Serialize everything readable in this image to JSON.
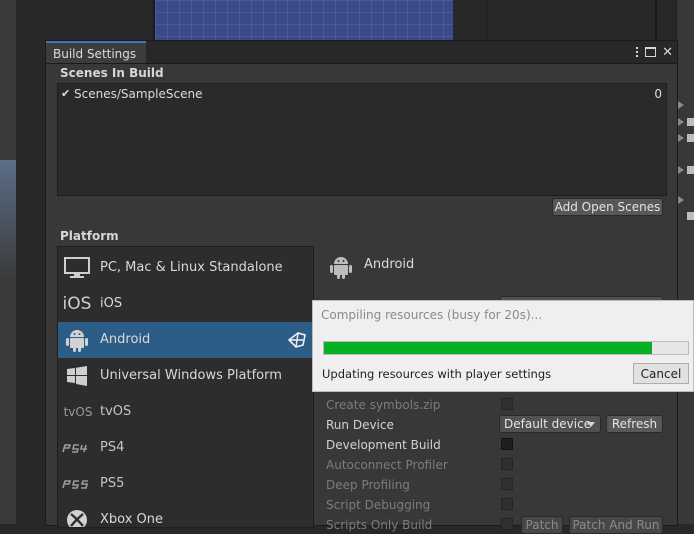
{
  "window": {
    "title": "Build Settings"
  },
  "scenes_in_build": {
    "label": "Scenes In Build",
    "scenes": [
      {
        "name": "Scenes/SampleScene",
        "index": "0",
        "checked": true
      }
    ],
    "add_open_scenes_label": "Add Open Scenes"
  },
  "platform": {
    "label": "Platform",
    "items": [
      {
        "label": "PC, Mac & Linux Standalone",
        "icon": "monitor-icon"
      },
      {
        "label": "iOS",
        "icon": "ios-icon",
        "icon_text": "iOS"
      },
      {
        "label": "Android",
        "icon": "android-icon",
        "selected": true
      },
      {
        "label": "Universal Windows Platform",
        "icon": "windows-icon"
      },
      {
        "label": "tvOS",
        "icon": "tvos-icon",
        "icon_text": "tvOS"
      },
      {
        "label": "PS4",
        "icon": "ps4-icon"
      },
      {
        "label": "PS5",
        "icon": "ps5-icon"
      },
      {
        "label": "Xbox One",
        "icon": "xbox-icon"
      }
    ],
    "selected_name": "Android"
  },
  "android_settings": {
    "create_symbols_zip": "Create symbols.zip",
    "run_device": "Run Device",
    "run_device_value": "Default device",
    "refresh_label": "Refresh",
    "development_build": "Development Build",
    "autoconnect_profiler": "Autoconnect Profiler",
    "deep_profiling": "Deep Profiling",
    "script_debugging": "Script Debugging",
    "scripts_only_build": "Scripts Only Build",
    "patch_label": "Patch",
    "patch_and_run_label": "Patch And Run"
  },
  "progress_dialog": {
    "title": "Compiling resources (busy for 20s)...",
    "status": "Updating resources with player settings",
    "progress": 0.9,
    "cancel_label": "Cancel"
  },
  "colors": {
    "progress_fill": "#06b025",
    "selected_item": "#2c5d87",
    "tab_accent": "#3a79bb"
  }
}
